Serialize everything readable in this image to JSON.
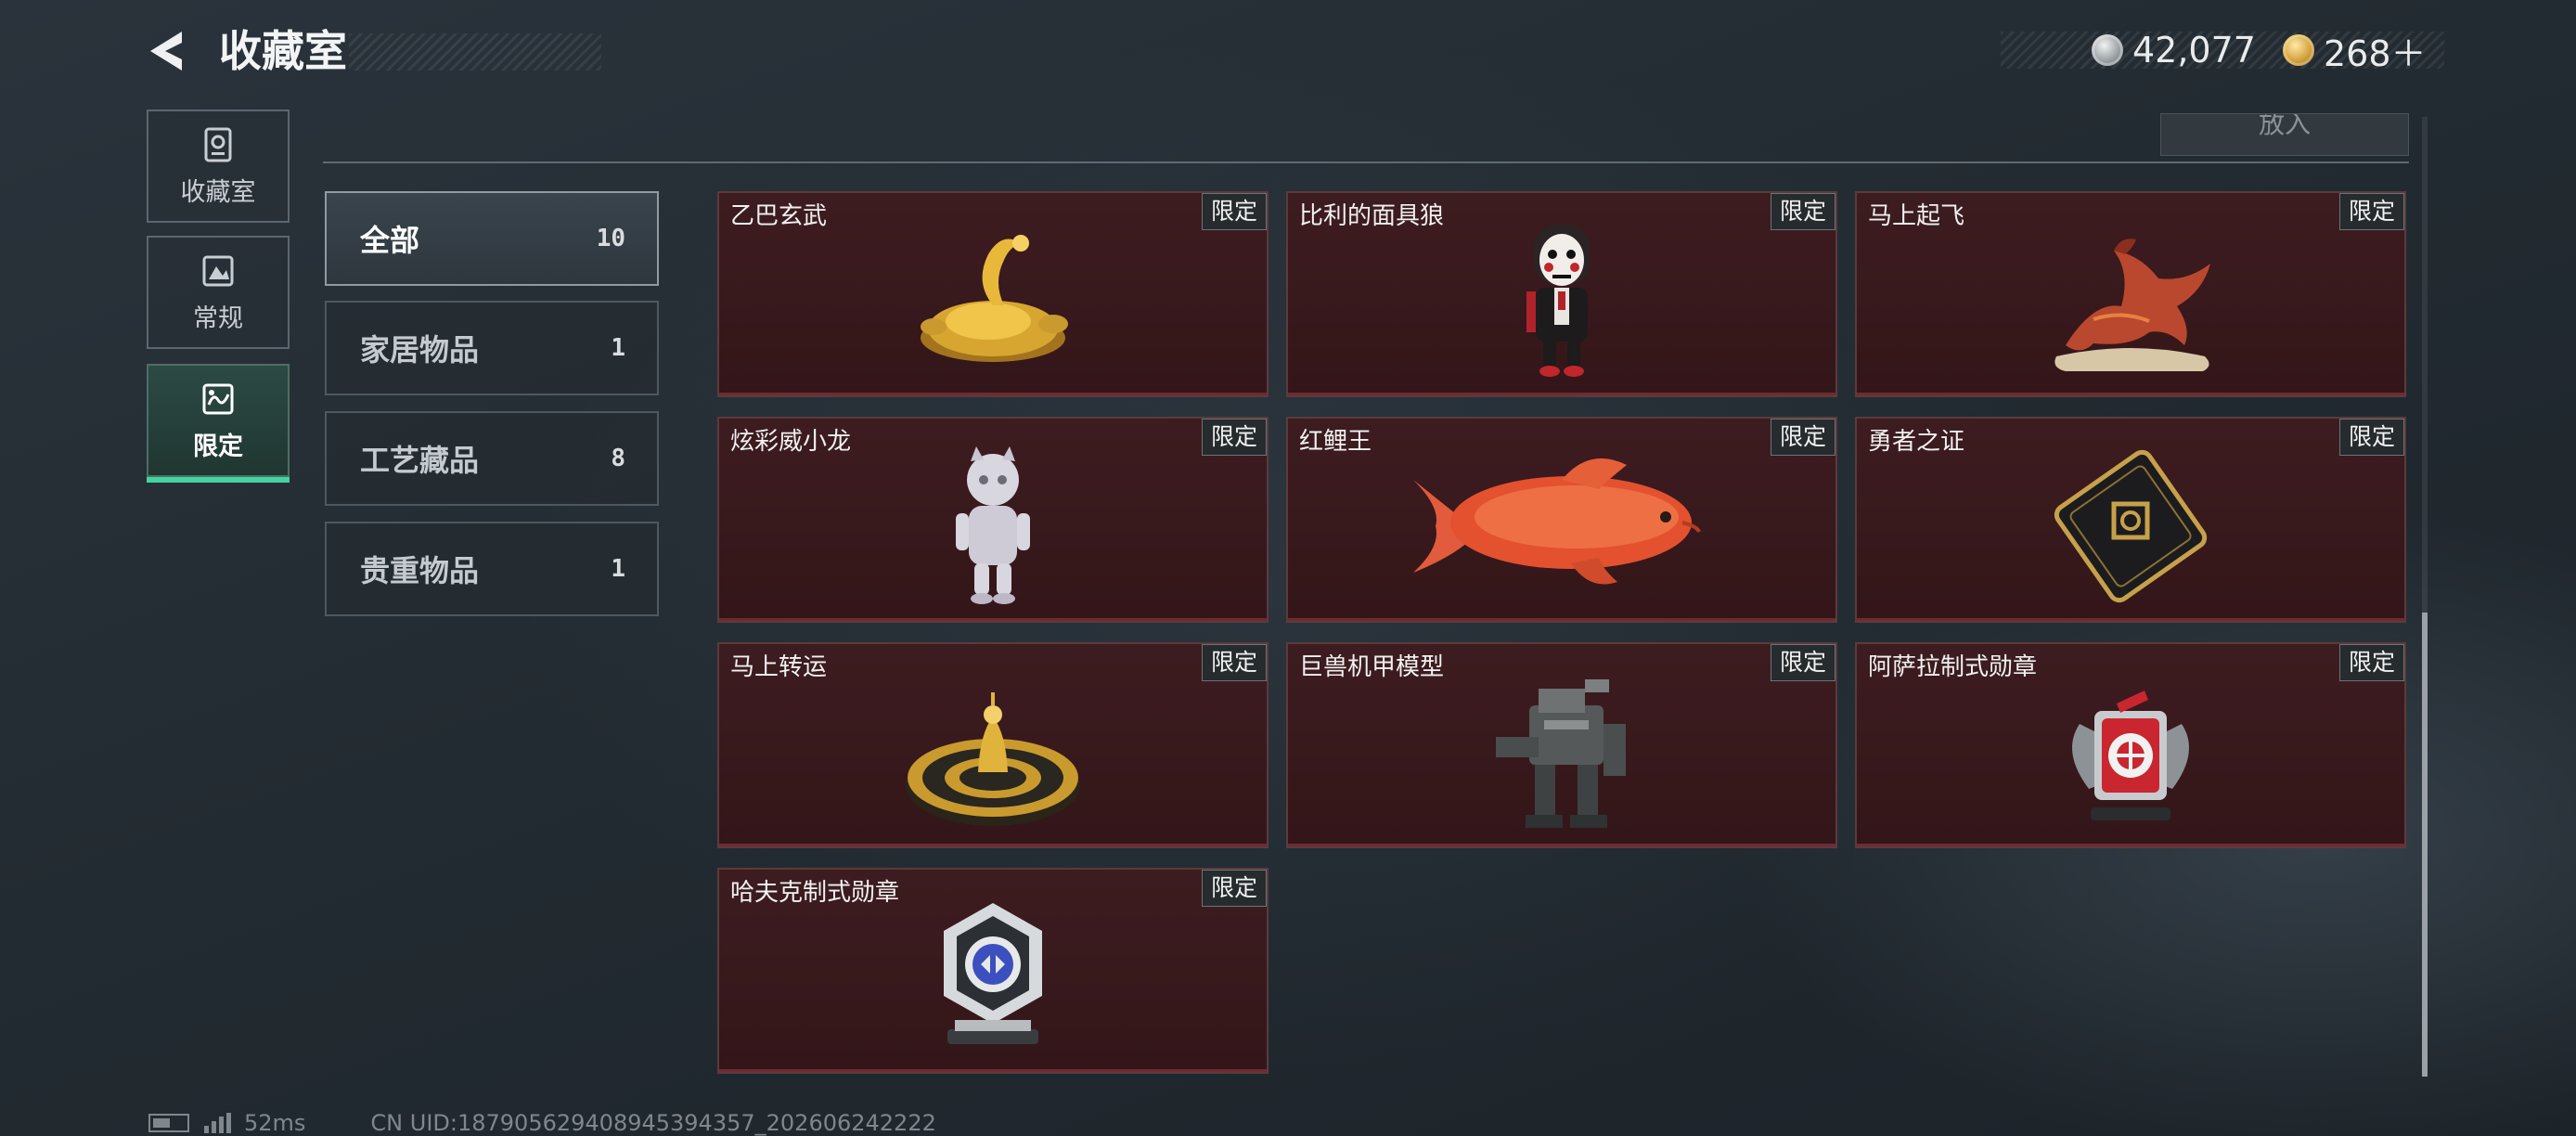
{
  "header": {
    "title": "收藏室",
    "currencies": [
      {
        "name": "silver-coin-icon",
        "value": "42,077"
      },
      {
        "name": "gold-coin-icon",
        "value": "268＋"
      }
    ]
  },
  "rail": [
    {
      "label": "收藏室",
      "icon": "collection-icon",
      "active": false
    },
    {
      "label": "常规",
      "icon": "regular-icon",
      "active": false
    },
    {
      "label": "限定",
      "icon": "limited-icon",
      "active": true
    }
  ],
  "toolbar": {
    "drop_label": "放入"
  },
  "categories": [
    {
      "name": "全部",
      "count": "10",
      "active": true
    },
    {
      "name": "家居物品",
      "count": "1",
      "active": false
    },
    {
      "name": "工艺藏品",
      "count": "8",
      "active": false
    },
    {
      "name": "贵重物品",
      "count": "1",
      "active": false
    }
  ],
  "items": [
    {
      "name": "乙巴玄武",
      "tag": "限定",
      "icon": "gold-turtle-statue-icon"
    },
    {
      "name": "比利的面具狼",
      "tag": "限定",
      "icon": "puppet-figure-icon"
    },
    {
      "name": "马上起飞",
      "tag": "限定",
      "icon": "flying-horse-icon"
    },
    {
      "name": "炫彩威小龙",
      "tag": "限定",
      "icon": "dragon-figure-icon"
    },
    {
      "name": "红鲤王",
      "tag": "限定",
      "icon": "red-carp-icon"
    },
    {
      "name": "勇者之证",
      "tag": "限定",
      "icon": "hero-card-icon"
    },
    {
      "name": "马上转运",
      "tag": "限定",
      "icon": "fortune-disc-icon"
    },
    {
      "name": "巨兽机甲模型",
      "tag": "限定",
      "icon": "mech-model-icon"
    },
    {
      "name": "阿萨拉制式勋章",
      "tag": "限定",
      "icon": "asala-medal-icon"
    },
    {
      "name": "哈夫克制式勋章",
      "tag": "限定",
      "icon": "haavk-medal-icon"
    }
  ],
  "footer": {
    "ping": "52ms",
    "uid": "CN UID:18790562940894539435​7_202606242222"
  }
}
